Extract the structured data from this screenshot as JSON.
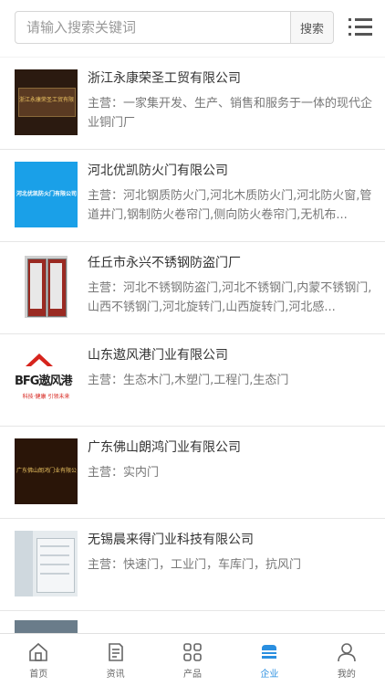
{
  "search": {
    "placeholder": "请输入搜索关键词",
    "button_label": "搜索"
  },
  "companies": [
    {
      "name": "浙江永康荣圣工贸有限公司",
      "desc": "主营：一家集开发、生产、销售和服务于一体的现代企业铜门厂",
      "thumb_text": "浙江永康荣圣工贸有限公司"
    },
    {
      "name": "河北优凯防火门有限公司",
      "desc": "主营：河北钢质防火门,河北木质防火门,河北防火窗,管道井门,钢制防火卷帘门,侧向防火卷帘门,无机布...",
      "thumb_text": "河北优凯防火门有限公司"
    },
    {
      "name": "任丘市永兴不锈钢防盗门厂",
      "desc": "主营：河北不锈钢防盗门,河北不锈钢门,内蒙不锈钢门,山西不锈钢门,河北旋转门,山西旋转门,河北感...",
      "thumb_text": ""
    },
    {
      "name": "山东遨风港门业有限公司",
      "desc": "主营：生态木门,木塑门,工程门,生态门",
      "thumb_text": "BFG遨风港",
      "thumb_sub": "科技·健康 引领未来"
    },
    {
      "name": "广东佛山朗鸿门业有限公司",
      "desc": "主营：实内门",
      "thumb_text": "广东佛山朗鸿门业有限公司"
    },
    {
      "name": "无锡晨来得门业科技有限公司",
      "desc": "主营：快速门，工业门，车库门，抗风门",
      "thumb_text": ""
    }
  ],
  "tabs": [
    {
      "label": "首页",
      "icon": "home-icon"
    },
    {
      "label": "资讯",
      "icon": "news-icon"
    },
    {
      "label": "产品",
      "icon": "grid-icon"
    },
    {
      "label": "企业",
      "icon": "company-icon",
      "active": true
    },
    {
      "label": "我的",
      "icon": "user-icon"
    }
  ],
  "colors": {
    "accent": "#2a8fe0",
    "thumb_brown": "#3b2416",
    "thumb_blue": "#1aa0e8",
    "logo_red": "#d6241d"
  }
}
